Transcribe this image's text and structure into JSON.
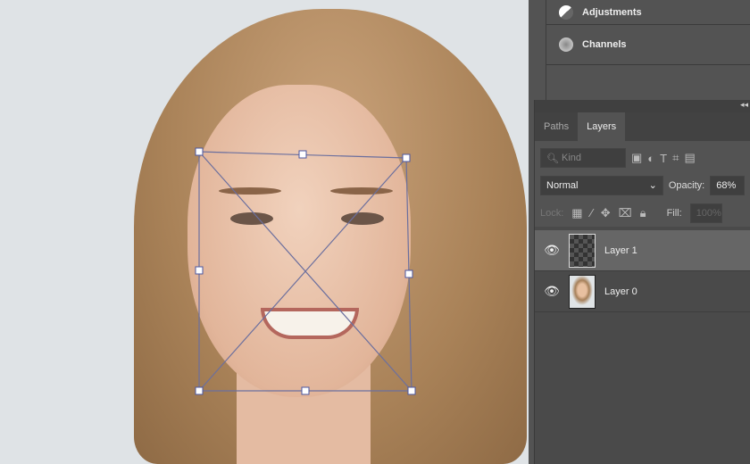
{
  "panels": {
    "adjustments": "Adjustments",
    "channels": "Channels"
  },
  "layers_panel": {
    "collapse": "◂◂",
    "tabs": [
      "Paths",
      "Layers"
    ],
    "active_tab": "Layers",
    "filter_placeholder": "Kind",
    "blend_mode": "Normal",
    "opacity_label": "Opacity:",
    "opacity_value": "68%",
    "lock_label": "Lock:",
    "fill_label": "Fill:",
    "fill_value": "100%",
    "layers": [
      {
        "name": "Layer 1",
        "selected": true,
        "visible": true
      },
      {
        "name": "Layer 0",
        "selected": false,
        "visible": true
      }
    ]
  }
}
